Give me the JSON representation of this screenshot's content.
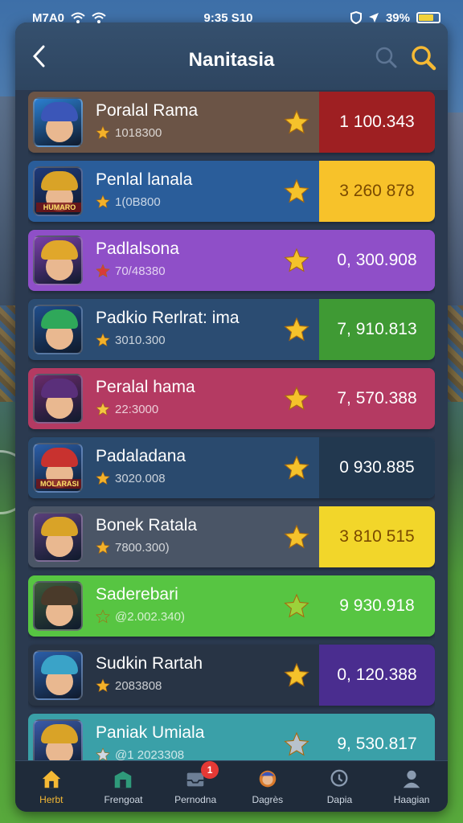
{
  "status_bar": {
    "time_left": "M7A0",
    "time_center": "9:35 S10",
    "battery_percent": "39%"
  },
  "header": {
    "title": "Nanitasia"
  },
  "rows": [
    {
      "name": "Poralal Rama",
      "sub": "1018300",
      "score": "1  100.343",
      "score_color": "#9e1f22",
      "row_color": "#6b5446",
      "mini_star_color": "#f3b12a",
      "star_color": "#f5c22b",
      "avatar_bg": "#2b7fd1",
      "helm_color": "#3b56b8",
      "tag": ""
    },
    {
      "name": "Penlal lanala",
      "sub": "1(0B800",
      "score": "3  260 878",
      "score_color": "#f7c22a",
      "row_color": "#2a5d9a",
      "mini_star_color": "#f3b12a",
      "star_color": "#f5c22b",
      "avatar_bg": "#1e3a7a",
      "helm_color": "#d9a327",
      "tag": "HUMARO"
    },
    {
      "name": "Padlalsona",
      "sub": "70/48380",
      "score": "0, 300.908",
      "score_color": "#8f4fc8",
      "row_color": "#8f4fc8",
      "mini_star_color": "#d93a3a",
      "star_color": "#f5c22b",
      "avatar_bg": "#7a3fa8",
      "helm_color": "#e0a72b",
      "tag": ""
    },
    {
      "name": "Padkio Rerlrat: ima",
      "sub": "3010.300",
      "score": "7, 910.813",
      "score_color": "#3f9a34",
      "row_color": "#2b4c72",
      "mini_star_color": "#f3b12a",
      "star_color": "#f5c22b",
      "avatar_bg": "#1f4d8a",
      "helm_color": "#2fa85a",
      "tag": ""
    },
    {
      "name": "Peralal hama",
      "sub": "22:3000",
      "score": "7, 570.388",
      "score_color": "#b43a62",
      "row_color": "#b43a62",
      "mini_star_color": "#f3c642",
      "star_color": "#f5c22b",
      "avatar_bg": "#6a2a6a",
      "helm_color": "#5a2f7a",
      "tag": ""
    },
    {
      "name": "Padaladana",
      "sub": "3020.008",
      "score": "0  930.885",
      "score_color": "#22384f",
      "row_color": "#2a4a6e",
      "mini_star_color": "#f3b12a",
      "star_color": "#f5c22b",
      "avatar_bg": "#2b5ea8",
      "helm_color": "#c8322f",
      "tag": "MOLARASI"
    },
    {
      "name": "Bonek Ratala",
      "sub": "7800.300)",
      "score": "3  810 515",
      "score_color": "#f2d62a",
      "row_color": "#4a5566",
      "mini_star_color": "#f3b12a",
      "star_color": "#f5c22b",
      "avatar_bg": "#5a3f7a",
      "helm_color": "#d9a327",
      "tag": ""
    },
    {
      "name": "Saderebari",
      "sub": "@2.002.340)",
      "score": "9  930.918",
      "score_color": "#57c542",
      "row_color": "#57c542",
      "mini_star_color": "#57c542",
      "star_color": "#9bd23a",
      "avatar_bg": "#3e5a3a",
      "helm_color": "#4a3a2a",
      "tag": ""
    },
    {
      "name": "Sudkin Rartah",
      "sub": "2083808",
      "score": "0, 120.388",
      "score_color": "#4a2d8f",
      "row_color": "#283445",
      "mini_star_color": "#f3b12a",
      "star_color": "#f5c22b",
      "avatar_bg": "#2b5ea8",
      "helm_color": "#3aa3c8",
      "tag": ""
    },
    {
      "name": "Paniak Umiala",
      "sub": "@1 2023308",
      "score": "9, 530.817",
      "score_color": "#3aa0a8",
      "row_color": "#3aa0a8",
      "mini_star_color": "#cfd8e3",
      "star_color": "#b8c2cc",
      "avatar_bg": "#3a5aa8",
      "helm_color": "#d9a327",
      "tag": ""
    }
  ],
  "tabs": [
    {
      "label": "Herbt",
      "icon": "home-icon",
      "active": true,
      "badge": ""
    },
    {
      "label": "Frengoat",
      "icon": "shop-icon",
      "active": false,
      "badge": ""
    },
    {
      "label": "Pernodna",
      "icon": "inbox-icon",
      "active": false,
      "badge": "1"
    },
    {
      "label": "Dagrès",
      "icon": "character-icon",
      "active": false,
      "badge": ""
    },
    {
      "label": "Dapia",
      "icon": "map-pin-icon",
      "active": false,
      "badge": ""
    },
    {
      "label": "Haagian",
      "icon": "profile-icon",
      "active": false,
      "badge": ""
    }
  ]
}
